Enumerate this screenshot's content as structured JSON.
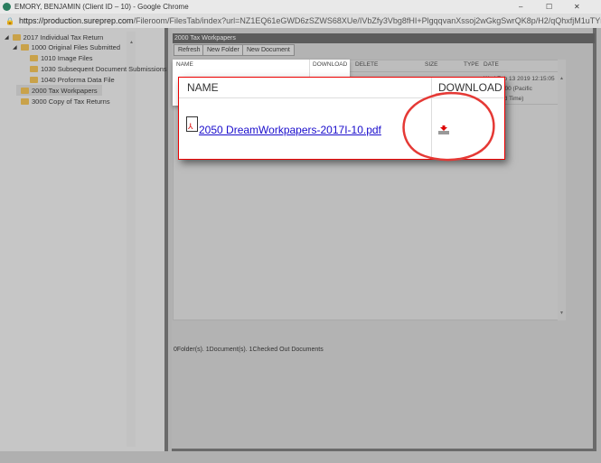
{
  "window": {
    "title": "EMORY, BENJAMIN (Client ID – 10) - Google Chrome",
    "url_host": "https://production.sureprep.com",
    "url_path": "/Fileroom/FilesTab/index?url=NZ1EQ61eGWD6zSZWS68XUe/IVbZfy3Vbg8fHI+PlgqqvanXssoj2wGkgSwrQK8p/H2/qQhxfjM1uTYr/OWYzlAOHIzrcY1SA8HGA...",
    "minimize": "–",
    "maximize": "☐",
    "close": "✕"
  },
  "tree": [
    {
      "label": "2017 Individual Tax Return"
    },
    {
      "label": "1000 Original Files Submitted"
    },
    {
      "label": "1010 Image Files"
    },
    {
      "label": "1030 Subsequent Document Submissions"
    },
    {
      "label": "1040 Proforma Data File"
    },
    {
      "label": "2000 Tax Workpapers"
    },
    {
      "label": "3000 Copy of Tax Returns"
    }
  ],
  "panel": {
    "title": "2000 Tax Workpapers",
    "buttons": [
      "Refresh",
      "New Folder",
      "New Document"
    ],
    "columns": [
      "NAME",
      "DOWNLOAD",
      "DELETE",
      "SIZE",
      "TYPE",
      "DATE"
    ],
    "row_date_lines": [
      "Wed Feb 13 2019 12:15:05",
      "GMT-0800 (Pacific",
      "Standard Time)"
    ],
    "status": "0Folder(s). 1Document(s). 1Checked Out Documents"
  },
  "popup": {
    "col_name": "NAME",
    "col_download": "DOWNLOAD",
    "file": " 2050 DreamWorkpapers-2017I-10.pdf"
  },
  "colors": {
    "highlight": "#e53935",
    "link": "#1a0dcc"
  }
}
